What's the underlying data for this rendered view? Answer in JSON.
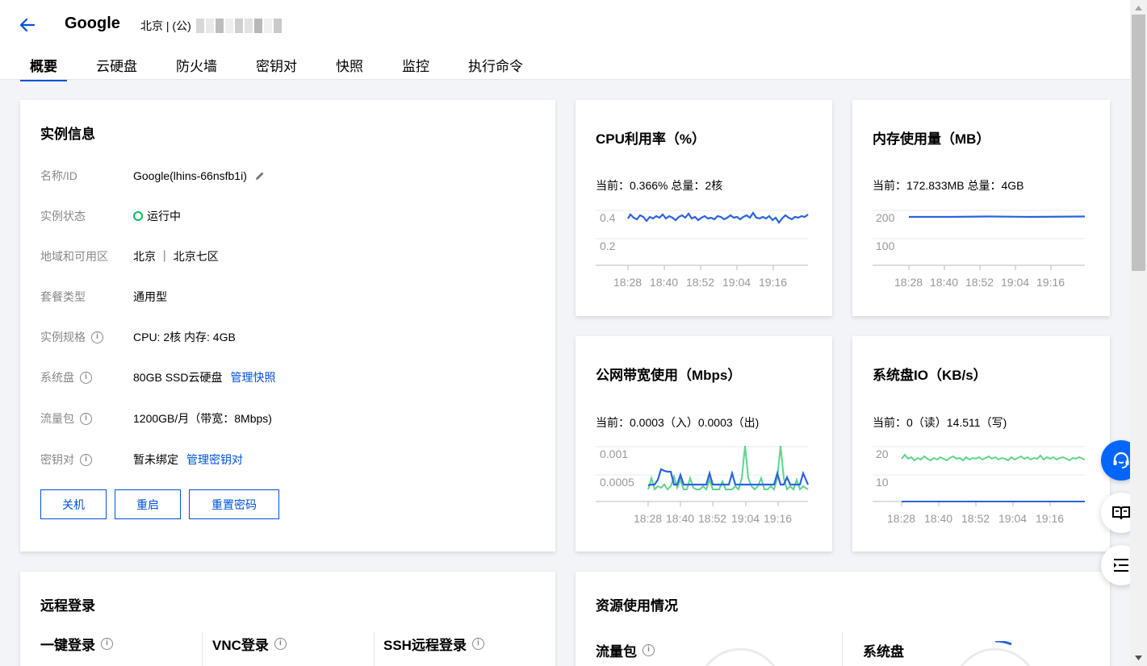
{
  "header": {
    "title": "Google",
    "subtitle": "北京 | (公)",
    "tabs": [
      {
        "label": "概要",
        "active": true
      },
      {
        "label": "云硬盘"
      },
      {
        "label": "防火墙"
      },
      {
        "label": "密钥对"
      },
      {
        "label": "快照"
      },
      {
        "label": "监控"
      },
      {
        "label": "执行命令"
      }
    ]
  },
  "instance": {
    "title": "实例信息",
    "rows": [
      {
        "label": "名称/ID",
        "value": "Google(lhins-66nsfb1i)"
      },
      {
        "label": "实例状态",
        "value": "运行中"
      },
      {
        "label": "地域和可用区",
        "value": "北京 ｜ 北京七区"
      },
      {
        "label": "套餐类型",
        "value": "通用型"
      },
      {
        "label": "实例规格",
        "value": "CPU: 2核 内存: 4GB"
      },
      {
        "label": "系统盘",
        "value": "80GB SSD云硬盘",
        "link": "管理快照"
      },
      {
        "label": "流量包",
        "value": "1200GB/月（带宽：8Mbps)"
      },
      {
        "label": "密钥对",
        "value": "暂未绑定",
        "link": "管理密钥对"
      }
    ],
    "buttons": {
      "shutdown": "关机",
      "restart": "重启",
      "reset_password": "重置密码"
    }
  },
  "monitors": {
    "cpu": {
      "title": "CPU利用率（%）",
      "current": "当前：0.366% 总量：2核",
      "y_ticks": [
        "0.4",
        "0.2"
      ],
      "x_ticks": [
        "18:28",
        "18:40",
        "18:52",
        "19:04",
        "19:16"
      ]
    },
    "mem": {
      "title": "内存使用量（MB）",
      "current": "当前：172.833MB 总量：4GB",
      "y_ticks": [
        "200",
        "100"
      ],
      "x_ticks": [
        "18:28",
        "18:40",
        "18:52",
        "19:04",
        "19:16"
      ]
    },
    "net": {
      "title": "公网带宽使用（Mbps）",
      "current": "当前：0.0003（入）0.0003（出)",
      "y_ticks": [
        "0.001",
        "0.0005"
      ],
      "x_ticks": [
        "18:28",
        "18:40",
        "18:52",
        "19:04",
        "19:16"
      ]
    },
    "disk": {
      "title": "系统盘IO（KB/s）",
      "current": "当前：0（读）14.511（写)",
      "y_ticks": [
        "20",
        "10"
      ],
      "x_ticks": [
        "18:28",
        "18:40",
        "18:52",
        "19:04",
        "19:16"
      ]
    }
  },
  "login": {
    "title": "远程登录",
    "methods": [
      "一键登录",
      "VNC登录",
      "SSH远程登录"
    ]
  },
  "resources": {
    "title": "资源使用情况",
    "items": [
      "流量包",
      "系统盘"
    ]
  },
  "colors": {
    "primary": "#0052d9",
    "line_blue": "#2a64e0",
    "line_green": "#5fd48a",
    "running": "#0abf5b"
  }
}
